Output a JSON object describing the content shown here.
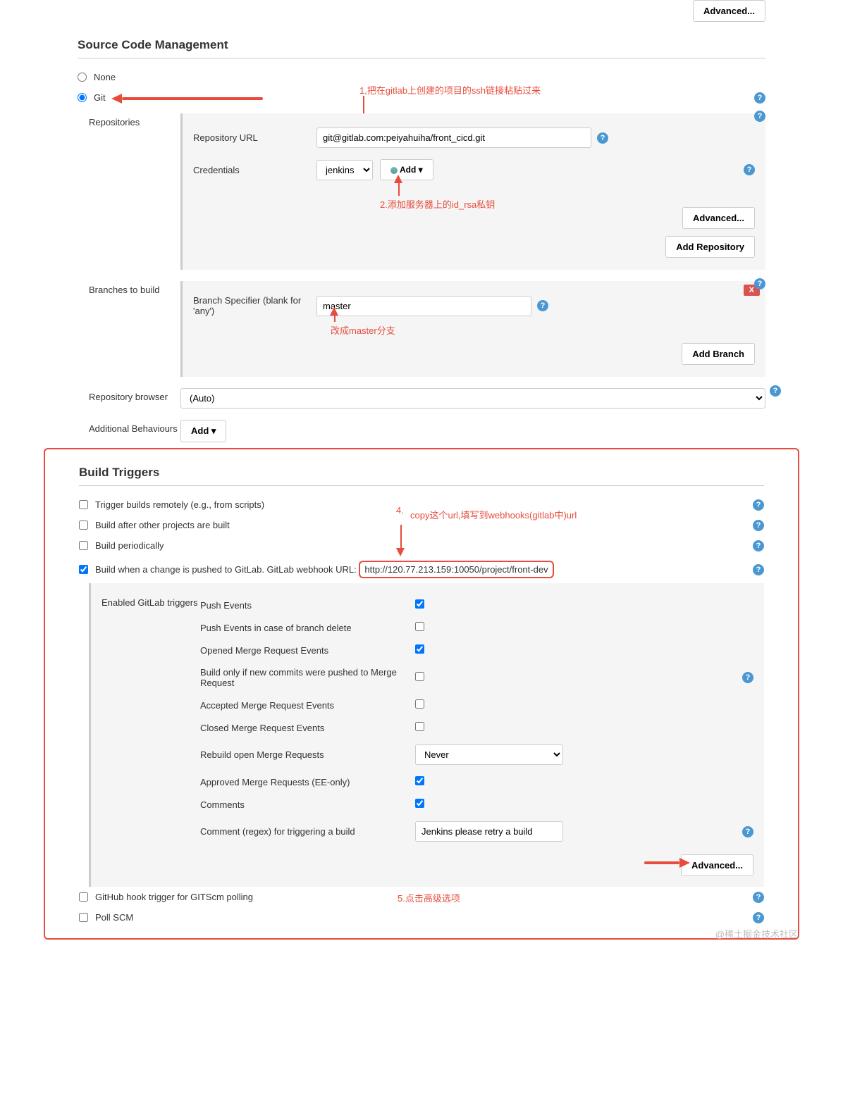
{
  "topAdvanced": "Advanced...",
  "scm": {
    "title": "Source Code Management",
    "none": "None",
    "git": "Git",
    "repositories": "Repositories",
    "repoUrl": "Repository URL",
    "repoUrlVal": "git@gitlab.com:peiyahuiha/front_cicd.git",
    "credentials": "Credentials",
    "credSel": "jenkins",
    "addBtn": "Add",
    "advanced": "Advanced...",
    "addRepo": "Add Repository",
    "branches": "Branches to build",
    "branchSpec": "Branch Specifier (blank for 'any')",
    "branchVal": "master",
    "addBranch": "Add Branch",
    "repoBrowser": "Repository browser",
    "repoBrowserVal": "(Auto)",
    "additional": "Additional Behaviours",
    "addBtn2": "Add",
    "xBtn": "X"
  },
  "ann": {
    "a1": "1,把在gitlab上创建的项目的ssh链接粘贴过来",
    "a2": "2.添加服务器上的id_rsa私钥",
    "a3": "改成master分支",
    "a4num": "4.",
    "a4": "copy这个url,填写到webhooks(gitlab中)url",
    "a5": "5.点击高级选项"
  },
  "triggers": {
    "title": "Build Triggers",
    "t1": "Trigger builds remotely (e.g., from scripts)",
    "t2": "Build after other projects are built",
    "t3": "Build periodically",
    "t4a": "Build when a change is pushed to GitLab. GitLab webhook URL:",
    "t4b": "http://120.77.213.159:10050/project/front-dev",
    "enabledLbl": "Enabled GitLab triggers",
    "events": [
      {
        "label": "Push Events",
        "checked": true,
        "type": "cb"
      },
      {
        "label": "Push Events in case of branch delete",
        "checked": false,
        "type": "cb"
      },
      {
        "label": "Opened Merge Request Events",
        "checked": true,
        "type": "cb"
      },
      {
        "label": "Build only if new commits were pushed to Merge Request",
        "checked": false,
        "type": "cb",
        "help": true
      },
      {
        "label": "Accepted Merge Request Events",
        "checked": false,
        "type": "cb"
      },
      {
        "label": "Closed Merge Request Events",
        "checked": false,
        "type": "cb"
      },
      {
        "label": "Rebuild open Merge Requests",
        "type": "select",
        "val": "Never"
      },
      {
        "label": "Approved Merge Requests (EE-only)",
        "checked": true,
        "type": "cb"
      },
      {
        "label": "Comments",
        "checked": true,
        "type": "cb"
      },
      {
        "label": "Comment (regex) for triggering a build",
        "type": "text",
        "val": "Jenkins please retry a build",
        "help": true
      }
    ],
    "advanced": "Advanced...",
    "t5": "GitHub hook trigger for GITScm polling",
    "t6": "Poll SCM"
  },
  "watermark": "@稀土掘金技术社区"
}
